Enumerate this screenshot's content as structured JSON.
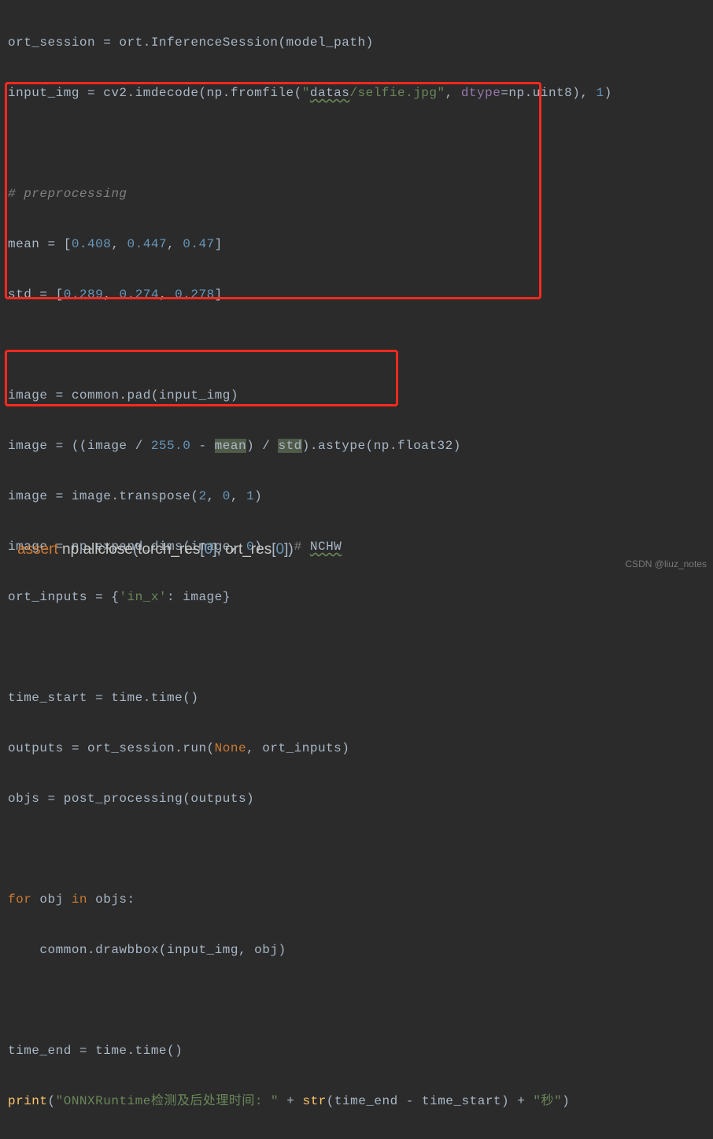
{
  "code": {
    "l1": {
      "a": "ort_session = ort.InferenceSession(model_path)"
    },
    "l2": {
      "a": "input_img = cv2.imdecode(np.fromfile(",
      "b": "\"",
      "c": "datas",
      "d": "/selfie.jpg\"",
      "e": ", ",
      "f": "dtype",
      "g": "=np.uint8), ",
      "h": "1",
      "i": ")"
    },
    "l4": {
      "a": "# preprocessing"
    },
    "l5": {
      "a": "mean = [",
      "b": "0.408",
      "c": ", ",
      "d": "0.447",
      "e": ", ",
      "f": "0.47",
      "g": "]"
    },
    "l6": {
      "a": "std = [",
      "b": "0.289",
      "c": ", ",
      "d": "0.274",
      "e": ", ",
      "f": "0.278",
      "g": "]"
    },
    "l8": {
      "a": "image = common.pad(input_img)"
    },
    "l9": {
      "a": "image = ((image / ",
      "b": "255.0",
      "c": " - ",
      "d": "mean",
      "e": ") / ",
      "f": "std",
      "g": ").astype(np.float32)"
    },
    "l10": {
      "a": "image = image.transpose(",
      "b": "2",
      "c": ", ",
      "d": "0",
      "e": ", ",
      "f": "1",
      "g": ")"
    },
    "l11": {
      "a": "image = np.expand_dims(image, ",
      "b": "0",
      "c": ")    ",
      "d": "# ",
      "e": "NCHW"
    },
    "l12": {
      "a": "ort_inputs = {",
      "b": "'in_x'",
      "c": ": image}"
    },
    "l14": {
      "a": "time_start = time.time()"
    },
    "l15": {
      "a": "outputs = ort_session.run(",
      "b": "None",
      "c": ", ort_inputs)"
    },
    "l16": {
      "a": "objs = post_processing(outputs)"
    },
    "l18": {
      "a": "for ",
      "b": "obj ",
      "c": "in ",
      "d": "objs:"
    },
    "l19": {
      "a": "    common.drawbbox(input_img, obj)"
    },
    "l21": {
      "a": "time_end = time.time()"
    },
    "l22": {
      "a": "print",
      "b": "(",
      "c": "\"ONNXRuntime检测及后处理时间: \"",
      "d": " + ",
      "e": "str",
      "f": "(time_end - time_start) + ",
      "g": "\"秒\"",
      "h": ")"
    }
  },
  "bottom": {
    "a": "assert ",
    "b": "np",
    "c": ".",
    "d": "allclose",
    "e": "(",
    "f": "torch_res",
    "g": "[",
    "h": "0",
    "i": "], ",
    "j": "ort_res",
    "k": "[",
    "l": "0",
    "m": "])"
  },
  "watermark": "CSDN @liuz_notes"
}
